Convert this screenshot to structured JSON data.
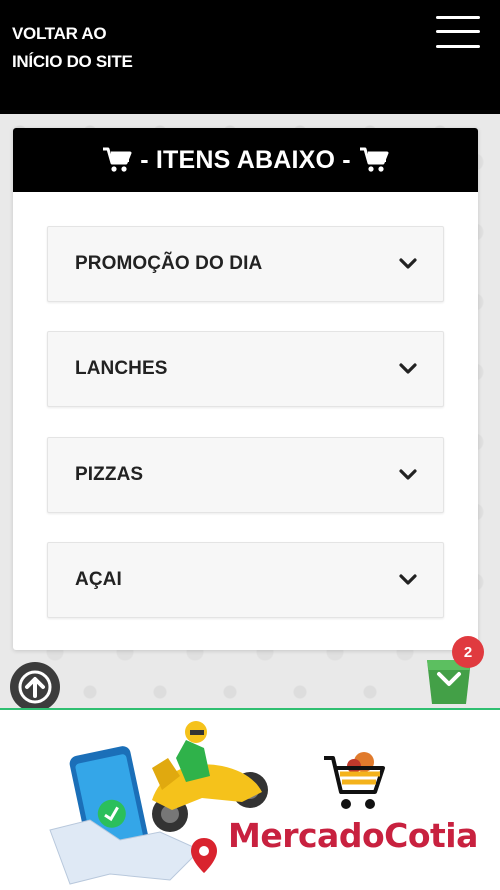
{
  "header": {
    "back_link": "VOLTAR AO INÍCIO DO SITE",
    "menu_icon": "hamburger-menu-icon"
  },
  "menu_card": {
    "title": "- ITENS ABAIXO -",
    "icon": "cart-icon",
    "categories": [
      {
        "label": "PROMOÇÃO DO DIA"
      },
      {
        "label": "LANCHES"
      },
      {
        "label": "PIZZAS"
      },
      {
        "label": "AÇAI"
      }
    ]
  },
  "floating": {
    "scroll_top_icon": "arrow-up-icon",
    "cart_icon": "shopping-bag-icon",
    "cart_count": "2"
  },
  "footer": {
    "brand": "MercadoCotia"
  },
  "colors": {
    "header_bg": "#000000",
    "brand_red": "#c8213f",
    "cart_green": "#43a047",
    "badge_red": "#e03a3f"
  }
}
